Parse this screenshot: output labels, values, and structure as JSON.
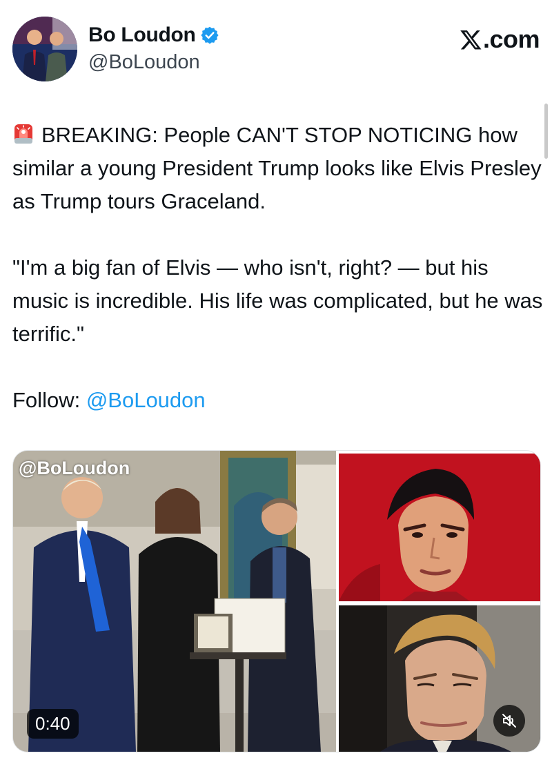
{
  "author": {
    "display_name": "Bo Loudon",
    "handle": "@BoLoudon",
    "verified_icon": "verified-badge-icon",
    "avatar_icon": "avatar-photo"
  },
  "brand": {
    "label": ".com",
    "logo_icon": "x-logo-icon"
  },
  "tweet": {
    "siren_icon": "police-light-emoji",
    "line1": "BREAKING: People CAN'T STOP NOTICING how similar a young President Trump looks like Elvis Presley as Trump tours Graceland.",
    "quote": "\"I'm a big fan of Elvis — who isn't, right? — but his music is incredible. His life was complicated, but he was terrific.\"",
    "follow_label": "Follow: ",
    "follow_handle": "@BoLoudon"
  },
  "media": {
    "watermark": "@BoLoudon",
    "video_duration": "0:40",
    "mute_icon": "muted-speaker-icon"
  },
  "colors": {
    "link": "#1d9bf0",
    "verified": "#1d9bf0",
    "text": "#0f1419",
    "secondary": "#3d4650"
  }
}
